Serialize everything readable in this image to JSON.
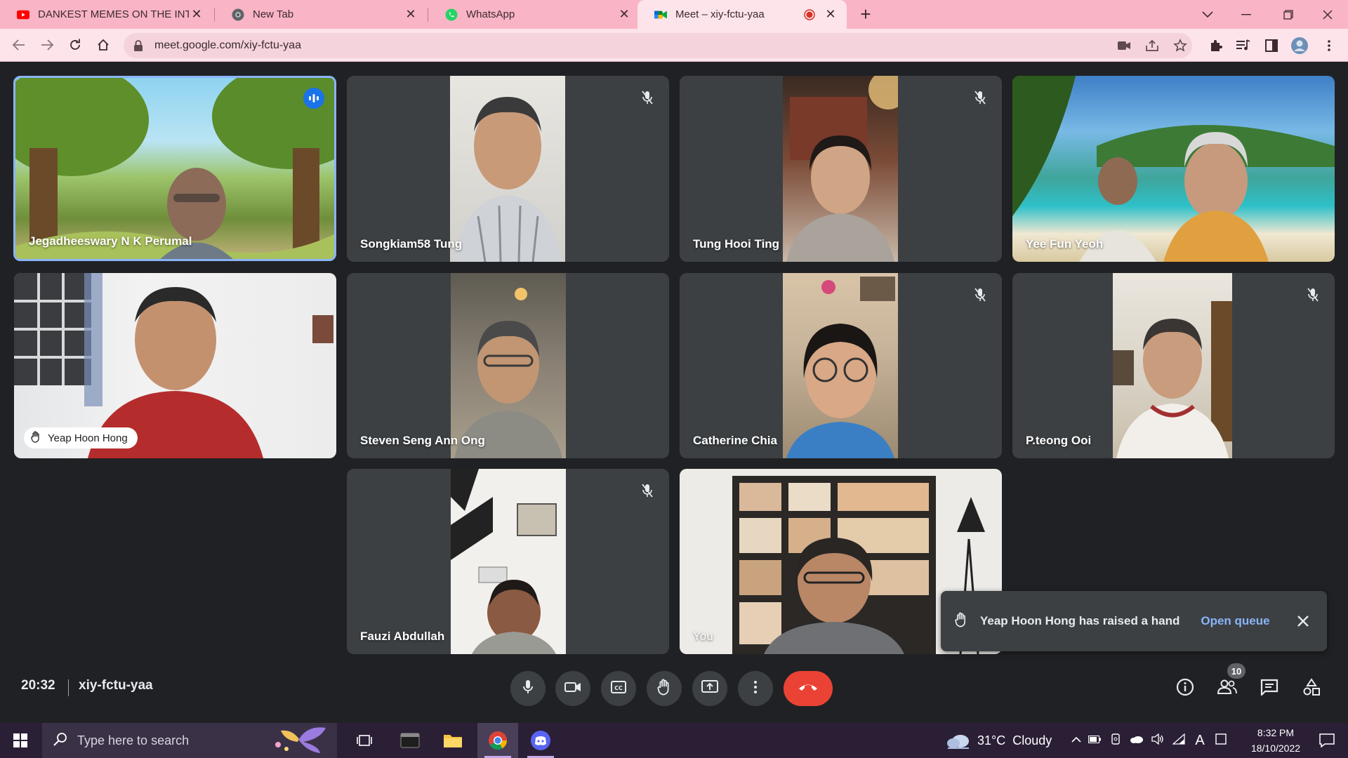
{
  "browser": {
    "tabs": [
      {
        "title": "DANKEST MEMES ON THE INTER",
        "icon": "youtube-icon"
      },
      {
        "title": "New Tab",
        "icon": "chrome-icon"
      },
      {
        "title": "WhatsApp",
        "icon": "whatsapp-icon"
      },
      {
        "title": "Meet – xiy-fctu-yaa",
        "icon": "meet-icon",
        "active": true,
        "recording": true
      }
    ],
    "url": "meet.google.com/xiy-fctu-yaa"
  },
  "meeting": {
    "time": "20:32",
    "code": "xiy-fctu-yaa",
    "participant_count": "10",
    "participants": [
      {
        "name": "Jegadheeswary N K Perumal",
        "muted": false,
        "speaking": true
      },
      {
        "name": "Songkiam58 Tung",
        "muted": true
      },
      {
        "name": "Tung Hooi Ting",
        "muted": true
      },
      {
        "name": "Yee Fun Yeoh",
        "muted": false
      },
      {
        "name": "Yeap Hoon Hong",
        "muted": false,
        "hand_raised": true
      },
      {
        "name": "Steven Seng Ann Ong",
        "muted": false
      },
      {
        "name": "Catherine Chia",
        "muted": true
      },
      {
        "name": "P.teong Ooi",
        "muted": true
      },
      {
        "name": "Fauzi Abdullah",
        "muted": true
      },
      {
        "name": "You",
        "muted": false
      }
    ],
    "toast": {
      "message": "Yeap Hoon Hong has raised a hand",
      "action": "Open queue"
    }
  },
  "taskbar": {
    "search_placeholder": "Type here to search",
    "weather": "31°C  Cloudy",
    "time": "8:32 PM",
    "date": "18/10/2022"
  },
  "colors": {
    "tab_strip": "#f9b4c6",
    "meet_bg": "#202124",
    "tile_bg": "#3c4043",
    "end_call": "#ea4335",
    "link": "#8ab4f8"
  }
}
